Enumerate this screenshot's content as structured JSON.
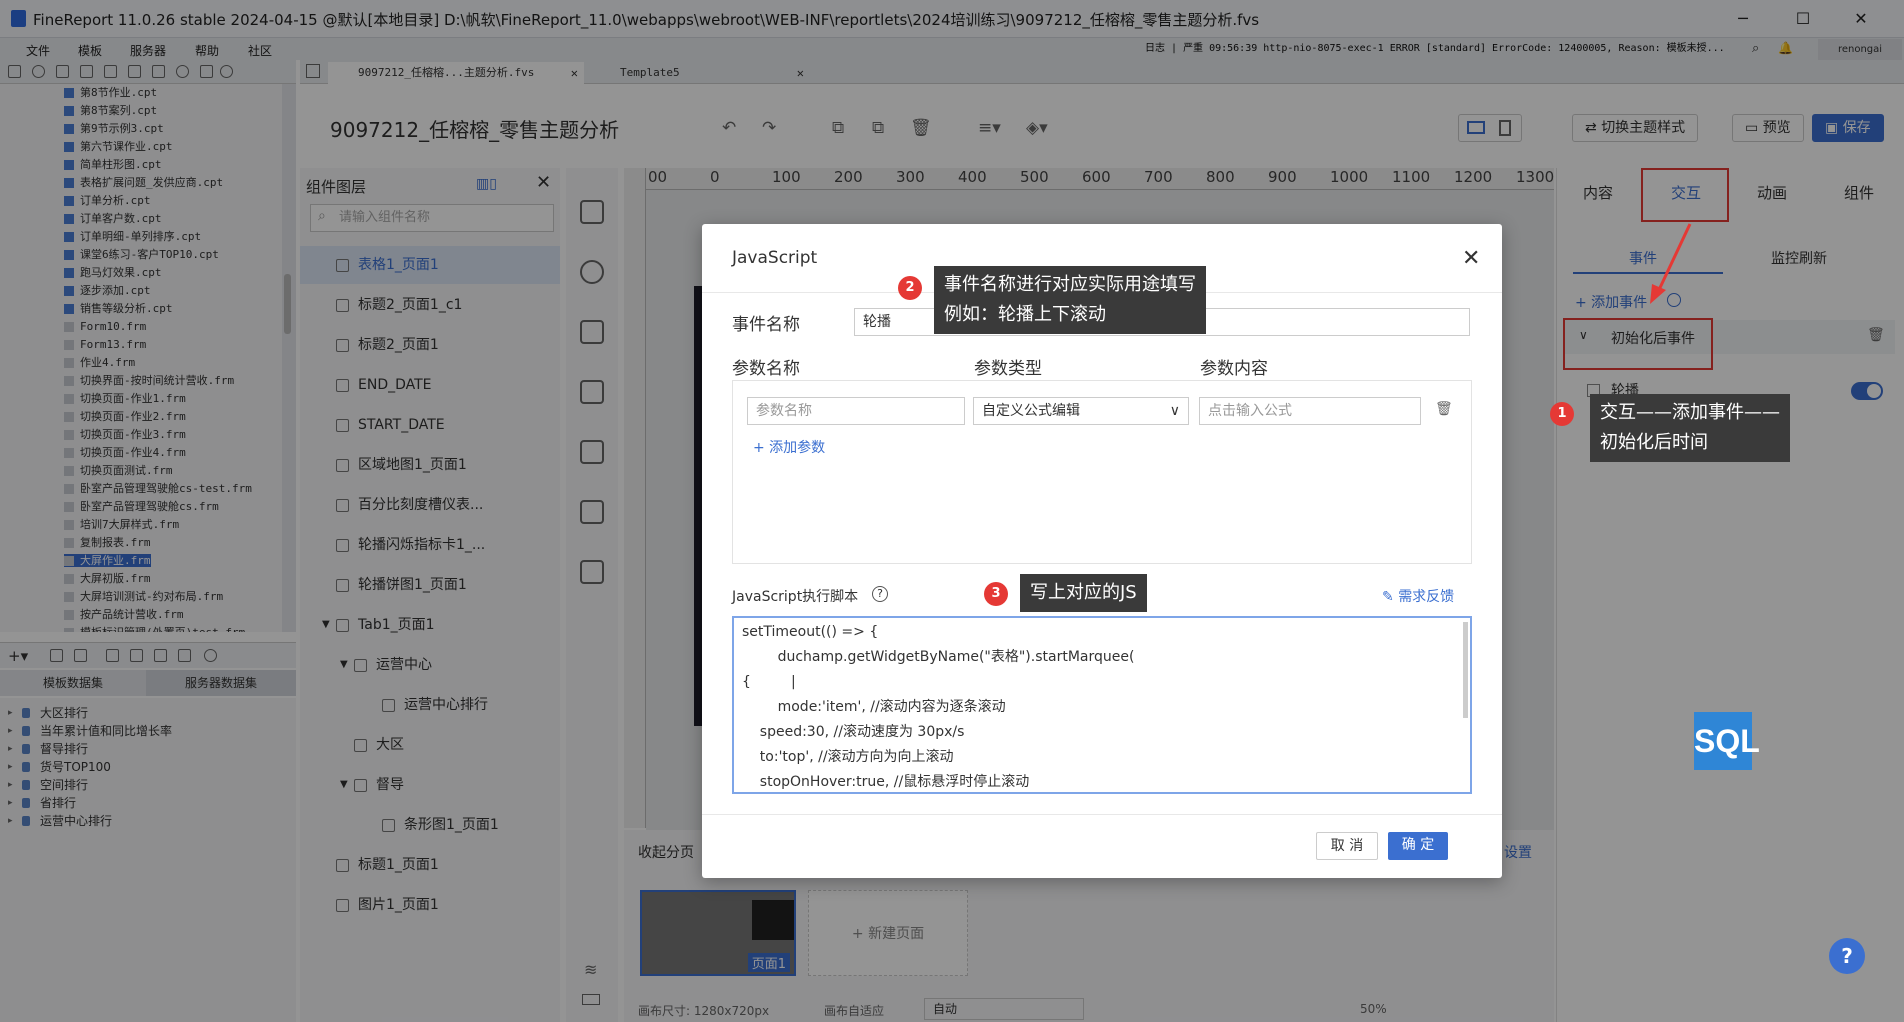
{
  "window": {
    "title": "FineReport 11.0.26 stable 2024-04-15 @默认[本地目录]    D:\\帆软\\FineReport_11.0\\webapps\\webroot\\WEB-INF\\reportlets\\2024培训练习\\9097212_任榕榕_零售主题分析.fvs"
  },
  "menu": [
    "文件",
    "模板",
    "服务器",
    "帮助",
    "社区"
  ],
  "logbar": {
    "label": "日志",
    "text": "严重 09:56:39 http-nio-8075-exec-1 ERROR [standard] ErrorCode: 12400005, Reason: 模板未授..."
  },
  "user": "renongai",
  "tree_files": [
    "第8节作业.cpt",
    "第8节案列.cpt",
    "第9节示例3.cpt",
    "第六节课作业.cpt",
    "简单柱形图.cpt",
    "表格扩展问题_发供应商.cpt",
    "订单分析.cpt",
    "订单客户数.cpt",
    "订单明细-单列排序.cpt",
    "课堂6练习-客户TOP10.cpt",
    "跑马灯效果.cpt",
    "逐步添加.cpt",
    "销售等级分析.cpt",
    "Form10.frm",
    "Form13.frm",
    "作业4.frm",
    "切换界面-按时间统计营收.frm",
    "切换页面-作业1.frm",
    "切换页面-作业2.frm",
    "切换页面-作业3.frm",
    "切换页面-作业4.frm",
    "切换页面测试.frm",
    "卧室产品管理驾驶舱cs-test.frm",
    "卧室产品管理驾驶舱cs.frm",
    "培训7大屏样式.frm",
    "复制报表.frm",
    "大屏作业.frm",
    "大屏初版.frm",
    "大屏培训测试-约对布局.frm",
    "按产品统计营收.frm",
    "模板标识管理(外置页)test.frm"
  ],
  "selected_file": "大屏作业.frm",
  "dataset_tabs": [
    "模板数据集",
    "服务器数据集"
  ],
  "datasets": [
    "大区排行",
    "当年累计值和同比增长率",
    "督导排行",
    "货号TOP100",
    "空间排行",
    "省排行",
    "运营中心排行"
  ],
  "file_tabs": [
    "9097212_任榕榕...主题分析.fvs",
    "Template5"
  ],
  "doc_title": "9097212_任榕榕_零售主题分析",
  "top_buttons": {
    "switch_theme": "切换主题样式",
    "preview": "预览",
    "save": "保存"
  },
  "layers": {
    "header": "组件图层",
    "search_placeholder": "请输入组件名称",
    "items": [
      "表格1_页面1",
      "标题2_页面1_c1",
      "标题2_页面1",
      "END_DATE",
      "START_DATE",
      "区域地图1_页面1",
      "百分比刻度槽仪表...",
      "轮播闪烁指标卡1_...",
      "轮播饼图1_页面1",
      "Tab1_页面1",
      "运营中心",
      "运营中心排行",
      "大区",
      "督导",
      "条形图1_页面1",
      "标题1_页面1",
      "图片1_页面1"
    ]
  },
  "ruler_ticks": [
    "00",
    "0",
    "100",
    "200",
    "300",
    "400",
    "500",
    "600",
    "700",
    "800",
    "900",
    "1000",
    "1100",
    "1200",
    "1300"
  ],
  "page_panel": {
    "collapse": "收起分页",
    "page1": "页面1",
    "new_page": "+ 新建页面",
    "settings": "设置",
    "canvas_size": "画布尺寸: 1280x720px",
    "canvas_adapt": "画布自适应",
    "adapt_value": "自动",
    "zoom": "50%"
  },
  "right_panel": {
    "tabs": [
      "内容",
      "交互",
      "动画",
      "组件"
    ],
    "subtabs": [
      "事件",
      "监控刷新"
    ],
    "add_event": "+ 添加事件",
    "event_group": "初始化后事件",
    "event_name": "轮播"
  },
  "dialog": {
    "title": "JavaScript",
    "event_name_label": "事件名称",
    "event_name_value": "轮播",
    "param_headers": [
      "参数名称",
      "参数类型",
      "参数内容"
    ],
    "param_name_placeholder": "参数名称",
    "param_type_value": "自定义公式编辑",
    "param_content_placeholder": "点击输入公式",
    "add_param": "+ 添加参数",
    "script_label": "JavaScript执行脚本",
    "feedback": "需求反馈",
    "script_lines": [
      "setTimeout(() => {",
      "        duchamp.getWidgetByName(\"表格\").startMarquee(",
      "{         |",
      "        mode:'item', //滚动内容为逐条滚动",
      "    speed:30, //滚动速度为 30px/s",
      "    to:'top', //滚动方向为向上滚动",
      "    stopOnHover:true, //鼠标悬浮时停止滚动"
    ],
    "cancel": "取 消",
    "confirm": "确 定"
  },
  "callouts": [
    {
      "num": "1",
      "lines": [
        "交互——添加事件——",
        "初始化后时间"
      ]
    },
    {
      "num": "2",
      "lines": [
        "事件名称进行对应实际用途填写",
        "例如：轮播上下滚动"
      ]
    },
    {
      "num": "3",
      "lines": [
        "写上对应的JS"
      ]
    }
  ],
  "sql_badge": "SQL",
  "help_badge": "?",
  "colors": {
    "accent": "#3b6fd0",
    "annotation": "#e53935",
    "callout_bg": "#3a3a3a"
  }
}
